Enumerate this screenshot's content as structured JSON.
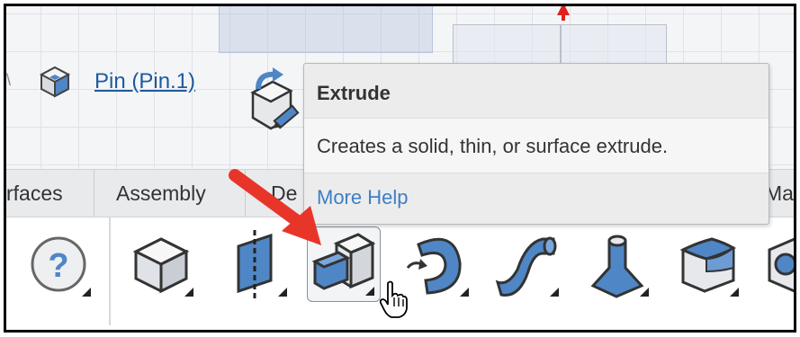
{
  "canvas": {
    "part_link": "Pin (Pin.1)",
    "part_icon": "part-cube-icon",
    "feature_tool_icon": "sketch-tool-icon"
  },
  "tabs": [
    {
      "label": "rfaces"
    },
    {
      "label": "Assembly"
    },
    {
      "label": "De"
    },
    {
      "label": "Ma"
    }
  ],
  "tooltip": {
    "title": "Extrude",
    "description": "Creates a solid, thin, or surface extrude.",
    "more_help": "More Help"
  },
  "toolbar": {
    "tools": [
      {
        "icon": "help-icon"
      },
      {
        "icon": "plane-box-icon"
      },
      {
        "icon": "split-plane-icon"
      },
      {
        "icon": "extrude-icon"
      },
      {
        "icon": "revolve-icon"
      },
      {
        "icon": "sweep-icon"
      },
      {
        "icon": "loft-icon"
      },
      {
        "icon": "fillet-icon"
      },
      {
        "icon": "shell-icon"
      }
    ]
  },
  "colors": {
    "link": "#1e5a9e",
    "help_link": "#3d7fc7",
    "tool_blue": "#4f86c6",
    "annotation_red": "#e8352a"
  }
}
